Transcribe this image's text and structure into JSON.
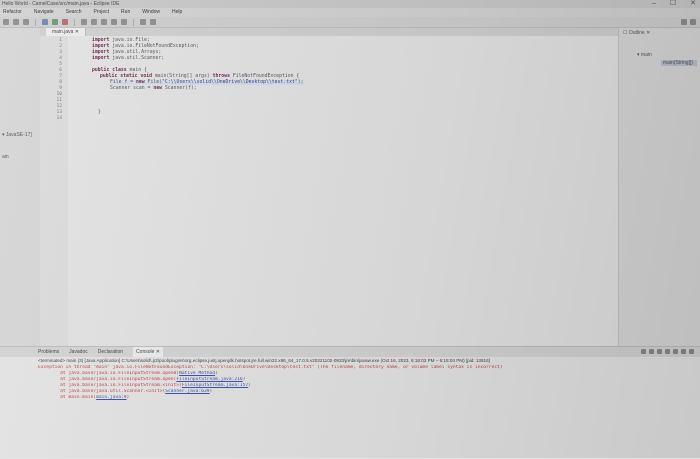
{
  "window": {
    "title": "Hello World - CamelCase/src/main.java - Eclipse IDE",
    "controls": [
      "–",
      "☐",
      "✕"
    ]
  },
  "menubar": {
    "items": [
      "Refactor",
      "Navigate",
      "Search",
      "Project",
      "Run",
      "Window",
      "Help"
    ]
  },
  "left_panel": {
    "items": [
      "▾ JavaSE-17]",
      "ain"
    ]
  },
  "editor": {
    "tab_label": "main.java ✕",
    "line_numbers": [
      "1",
      "2",
      "3",
      "4",
      "5",
      "6",
      "7",
      "8",
      "9",
      "10",
      "11",
      "12",
      "13",
      "14"
    ],
    "code": {
      "l1_kw": "import",
      "l1_rest": " java.io.File;",
      "l2_kw": "import",
      "l2_rest": " java.io.FileNotFoundException;",
      "l3_kw": "import",
      "l3_rest": " java.util.Arrays;",
      "l4_kw": "import",
      "l4_rest": " java.util.Scanner;",
      "l6_kw": "public class",
      "l6_rest": " main {",
      "l7_kw": "public static void",
      "l7_rest": " main(String[] args) ",
      "l7_kw2": "throws",
      "l7_rest2": " FileNotFoundException {",
      "l8_pre": "File f = ",
      "l8_kw": "new",
      "l8_mid": " File(",
      "l8_str": "\"C:\\\\Users\\\\solid\\\\OneDrive\\\\Desktop\\\\test.txt\"",
      "l8_post": ");",
      "l9_pre": "Scanner scan = ",
      "l9_kw": "new",
      "l9_post": " Scanner(f);",
      "l13": "}"
    }
  },
  "right_panel": {
    "top": "☐ Outline ✕",
    "items": [
      "▾ main",
      "main(String[])"
    ]
  },
  "console": {
    "tabs": [
      "Problems",
      "Javadoc",
      "Declaration",
      "Console ✕"
    ],
    "terminated": "<terminated> main (3) [Java Application] C:\\Users\\solid\\.p2\\pool\\plugins\\org.eclipse.justj.openjdk.hotspot.jre.full.win32.x86_64_17.0.5.v20221102-0933\\jre\\bin\\javaw.exe (Oct 16, 2023, 6:18:03 PM – 6:18:04 PM) [pid: 13816]",
    "exception_pre": "Exception in thread \"main\" java.io.FileNotFoundException: \"C:\\Users\\solid\\OneDrive\\Desktop\\test.txt\" (The filename, directory name, or volume label syntax is incorrect)",
    "stack": [
      {
        "pre": "\tat java.base/java.io.FileInputStream.open0(",
        "link": "Native Method",
        "post": ")"
      },
      {
        "pre": "\tat java.base/java.io.FileInputStream.open(",
        "link": "FileInputStream.java:216",
        "post": ")"
      },
      {
        "pre": "\tat java.base/java.io.FileInputStream.<init>(",
        "link": "FileInputStream.java:157",
        "post": ")"
      },
      {
        "pre": "\tat java.base/java.util.Scanner.<init>(",
        "link": "Scanner.java:639",
        "post": ")"
      },
      {
        "pre": "\tat main.main(",
        "link": "main.java:9",
        "post": ")"
      }
    ]
  },
  "colors": {
    "keyword": "#6b2a50",
    "string": "#2a3f9a",
    "error_text": "#c04040",
    "link": "#3a4fb0"
  }
}
